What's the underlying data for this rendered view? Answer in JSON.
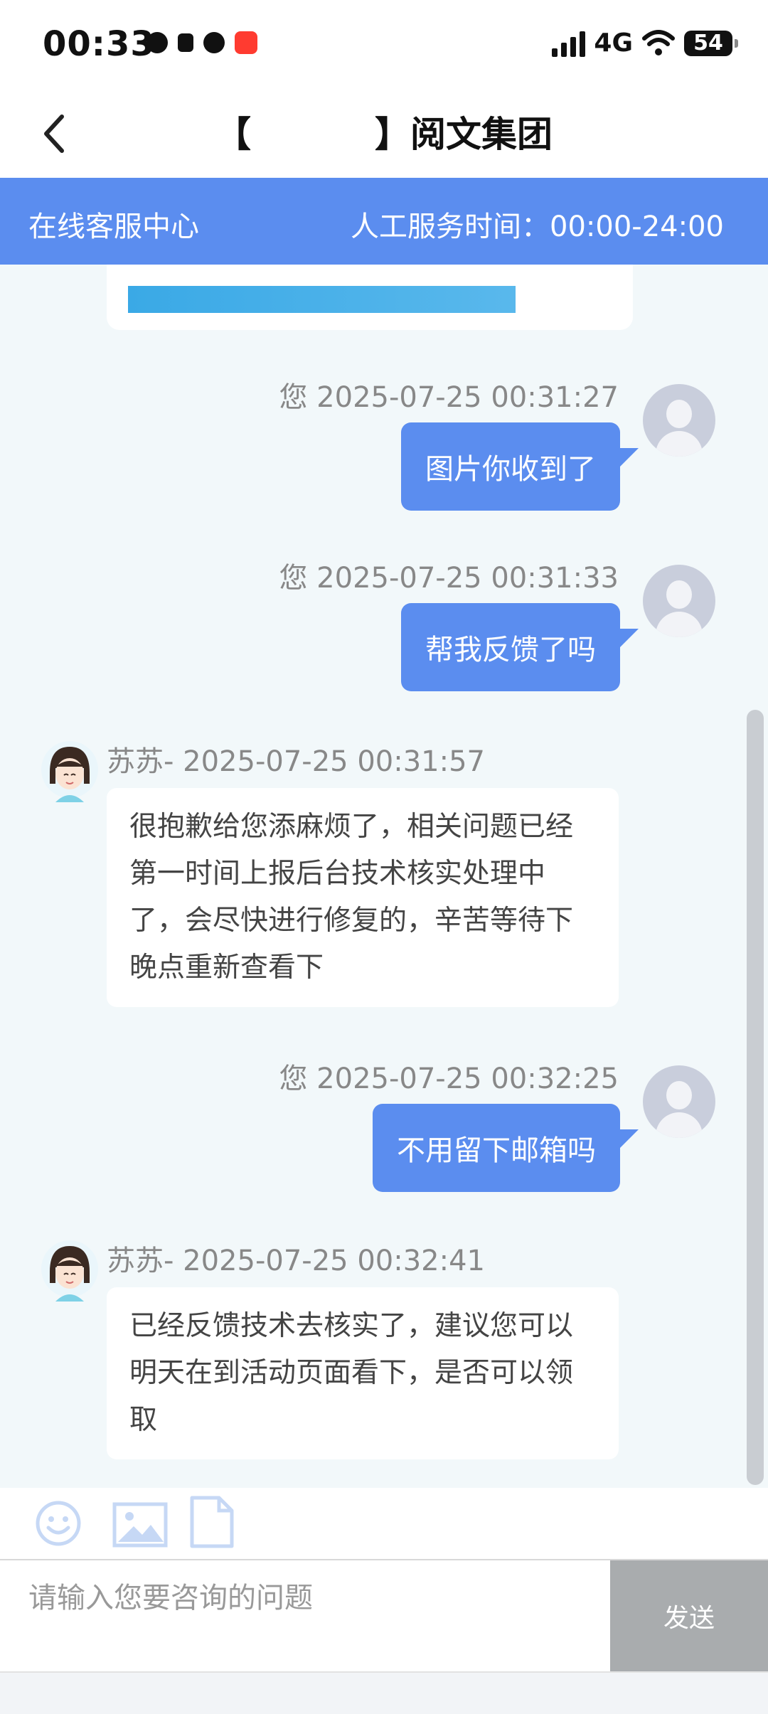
{
  "status_bar": {
    "time": "00:33",
    "network": "4G",
    "battery": "54"
  },
  "header": {
    "title": "【          】阅文集团"
  },
  "service": {
    "left_label": "在线客服中心",
    "right_label": "人工服务时间：00:00-24:00",
    "accent_color": "#5b8def"
  },
  "messages": [
    {
      "sender": "您",
      "time": "2025-07-25 00:31:27",
      "meta": "您 2025-07-25 00:31:27",
      "text": "图片你收到了",
      "side": "out"
    },
    {
      "sender": "您",
      "time": "2025-07-25 00:31:33",
      "meta": "您 2025-07-25 00:31:33",
      "text": "帮我反馈了吗",
      "side": "out"
    },
    {
      "sender": "苏苏-",
      "time": "2025-07-25 00:31:57",
      "meta": "苏苏- 2025-07-25 00:31:57",
      "text": "很抱歉给您添麻烦了，相关问题已经第一时间上报后台技术核实处理中了，会尽快进行修复的，辛苦等待下晚点重新查看下",
      "side": "in"
    },
    {
      "sender": "您",
      "time": "2025-07-25 00:32:25",
      "meta": "您 2025-07-25 00:32:25",
      "text": "不用留下邮箱吗",
      "side": "out"
    },
    {
      "sender": "苏苏-",
      "time": "2025-07-25 00:32:41",
      "meta": "苏苏- 2025-07-25 00:32:41",
      "text": "已经反馈技术去核实了，建议您可以明天在到活动页面看下，是否可以领取",
      "side": "in"
    }
  ],
  "toolbar": {
    "icons": [
      "emoji-icon",
      "image-icon",
      "file-icon"
    ]
  },
  "composer": {
    "placeholder": "请输入您要咨询的问题",
    "send_label": "发送"
  }
}
